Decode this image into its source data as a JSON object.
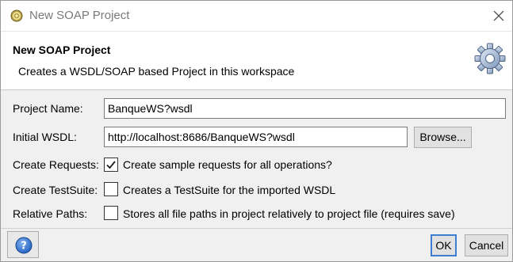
{
  "window": {
    "title": "New SOAP Project",
    "app_icon": "soapui-icon",
    "close_icon": "close-icon"
  },
  "banner": {
    "title": "New SOAP Project",
    "description": "Creates a WSDL/SOAP based Project in this workspace",
    "icon": "gear-icon"
  },
  "form": {
    "project_name_label": "Project Name:",
    "project_name_value": "BanqueWS?wsdl",
    "initial_wsdl_label": "Initial WSDL:",
    "initial_wsdl_value": "http://localhost:8686/BanqueWS?wsdl",
    "browse_label": "Browse...",
    "create_requests_label": "Create Requests:",
    "create_requests_text": "Create sample requests for all operations?",
    "create_requests_checked": true,
    "create_testsuite_label": "Create TestSuite:",
    "create_testsuite_text": "Creates a TestSuite for the imported WSDL",
    "create_testsuite_checked": false,
    "relative_paths_label": "Relative Paths:",
    "relative_paths_text": "Stores all file paths in project relatively to project file (requires save)",
    "relative_paths_checked": false
  },
  "footer": {
    "help_icon": "help-icon",
    "ok_label": "OK",
    "cancel_label": "Cancel"
  },
  "colors": {
    "dialog_bg": "#f0f0f0",
    "banner_bg": "#ffffff",
    "accent": "#3c7fd1",
    "help_blue": "#2a6fcf"
  }
}
